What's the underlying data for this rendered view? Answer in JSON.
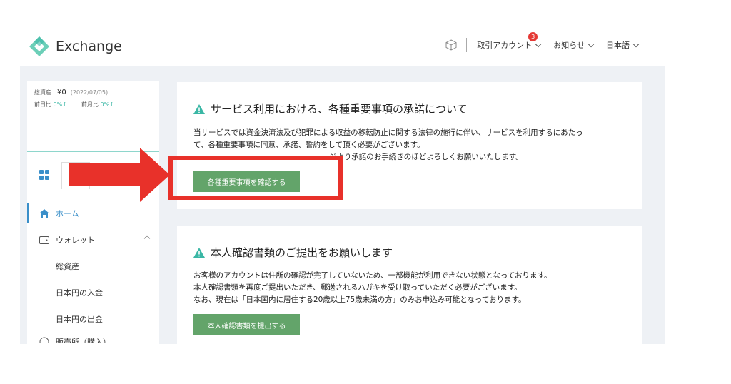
{
  "header": {
    "logo_text": "Exchange",
    "account_label": "取引アカウント",
    "account_badge": "3",
    "notice_label": "お知らせ",
    "language_label": "日本語"
  },
  "sidebar": {
    "total_assets_label": "総資産",
    "total_assets_value": "¥0",
    "date": "(2022/07/05)",
    "day_change_label": "前日比",
    "day_change_value": "0%",
    "month_change_label": "前月比",
    "month_change_value": "0%",
    "items": [
      {
        "label": "ホーム"
      },
      {
        "label": "ウォレット"
      },
      {
        "label": "総資産"
      },
      {
        "label": "日本円の入金"
      },
      {
        "label": "日本円の出金"
      },
      {
        "label": "販売所（購入）"
      }
    ]
  },
  "card1": {
    "title": "サービス利用における、各種重要事項の承諾について",
    "line1": "当サービスでは資金決済法及び犯罪による収益の移転防止に関する法律の施行に伴い、サービスを利用するにあたっ",
    "line2": "て、各種重要事項に同意、承諾、誓約をして頂く必要がございます。",
    "line3": "ジより承諾のお手続きのほどよろしくお願いいたします。",
    "button": "各種重要事項を確認する"
  },
  "card2": {
    "title": "本人確認書類のご提出をお願いします",
    "line1": "お客様のアカウントは住所の確認が完了していないため、一部機能が利用できない状態となっております。",
    "line2": "本人確認書類を再度ご提出いただき、郵送されるハガキを受け取っていただく必要がございます。",
    "line3": "なお、現在は「日本国内に居住する20歳以上75歳未満の方」のみお申込み可能となっております。",
    "button": "本人確認書類を提出する"
  },
  "colors": {
    "accent_green": "#63a46a",
    "annotation_red": "#e8312a",
    "nav_blue": "#3a8fc9"
  }
}
